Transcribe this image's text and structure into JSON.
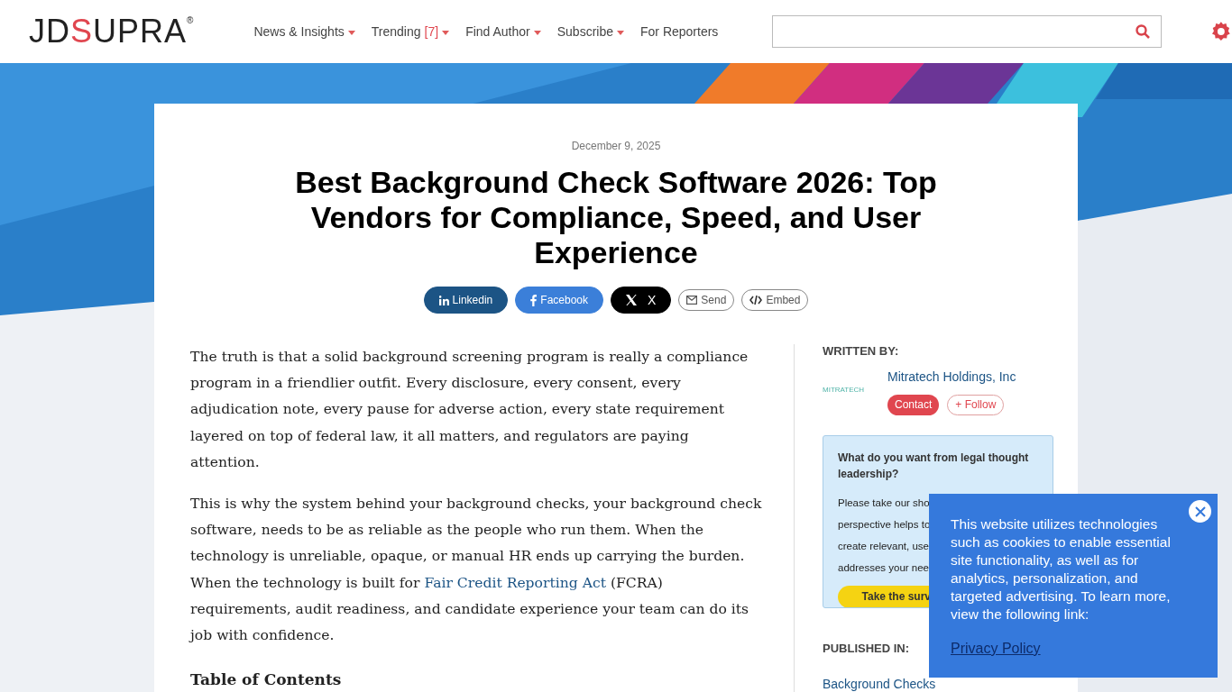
{
  "header": {
    "logo": {
      "before": "JD",
      "accent": "S",
      "after": "UPRA",
      "mark": "®"
    },
    "nav": [
      {
        "label": "News & Insights",
        "has_menu": true
      },
      {
        "label": "Trending",
        "count": "[7]",
        "has_menu": true
      },
      {
        "label": "Find Author",
        "has_menu": true
      },
      {
        "label": "Subscribe",
        "has_menu": true
      },
      {
        "label": "For Reporters",
        "has_menu": false
      }
    ]
  },
  "article": {
    "date": "December 9, 2025",
    "title": "Best Background Check Software 2026: Top Vendors for Compliance, Speed, and User Experience",
    "share": [
      {
        "kind": "linkedin",
        "label": "Linkedin"
      },
      {
        "kind": "facebook",
        "label": "Facebook"
      },
      {
        "kind": "x",
        "label": "X"
      },
      {
        "kind": "send",
        "label": "Send"
      },
      {
        "kind": "embed",
        "label": "Embed"
      }
    ],
    "paragraphs": [
      {
        "text": "The truth is that a solid background screening program is really a compliance program in a friendlier outfit. Every disclosure, every consent, every adjudication note, every pause for adverse action, every state requirement layered on top of federal law, it all matters, and regulators are paying attention."
      },
      {
        "text": "This is why the system behind your background checks, your background check software, needs to be as reliable as the people who run them. When the technology is unreliable, opaque, or manual HR ends up carrying the burden. When the technology is built for",
        "link": "Fair Credit Reporting Act",
        "after": "(FCRA) requirements, audit readiness, and candidate experience your team can do its job with confidence."
      }
    ],
    "toc_heading": "Table of Contents"
  },
  "sidebar": {
    "written_by": "WRITTEN BY:",
    "author": {
      "logo": "MITRATECH",
      "name": "Mitratech Holdings, Inc",
      "contact": "Contact",
      "follow": "+ Follow"
    },
    "survey": {
      "question": "What do you want from legal thought leadership?",
      "lines": [
        "Please take our sho",
        "perspective helps to",
        "create relevant, use",
        "addresses your nee"
      ],
      "button": "Take the surv"
    },
    "published_in": "PUBLISHED IN:",
    "topic": "Background Checks"
  },
  "cookie": {
    "text": "This website utilizes technologies such as cookies to enable essential site functionality, as well as for analytics, personalization, and targeted advertising. To learn more, view the following link:",
    "link": "Privacy Policy"
  }
}
